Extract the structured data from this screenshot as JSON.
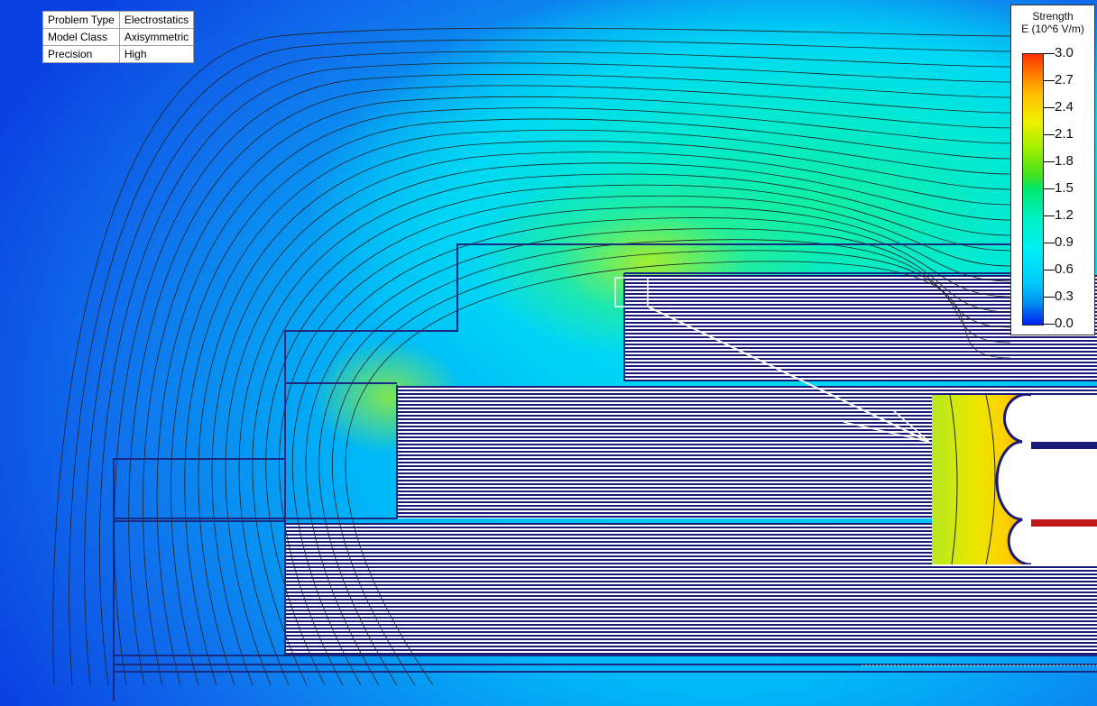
{
  "info_table": [
    {
      "label": "Problem Type",
      "value": "Electrostatics"
    },
    {
      "label": "Model Class",
      "value": "Axisymmetric"
    },
    {
      "label": "Precision",
      "value": "High"
    }
  ],
  "legend": {
    "title_line1": "Strength",
    "title_line2": "E (10^6 V/m)",
    "ticks": [
      "3.0",
      "2.7",
      "2.4",
      "2.1",
      "1.8",
      "1.5",
      "1.2",
      "0.9",
      "0.6",
      "0.3",
      "0.0"
    ],
    "min": 0.0,
    "max": 3.0
  },
  "colors": {
    "conductor_stripe": "#1a1a7a",
    "outline": "#1a2a80",
    "field_line": "#202020",
    "scale_low": "#0020f0",
    "scale_high": "#ff3000"
  }
}
